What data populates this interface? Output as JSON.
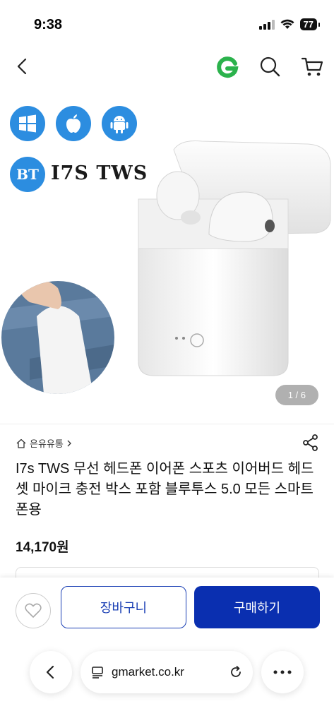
{
  "status": {
    "time": "9:38",
    "battery": "77"
  },
  "hero": {
    "brand_badge": "BT",
    "model_text": "I7S TWS",
    "page_indicator": "1 / 6"
  },
  "product": {
    "seller": "은유유통",
    "title": "I7s TWS 무선 헤드폰 이어폰 스포츠 이어버드 헤드셋 마이크 충전 박스 포함 블루투스 5.0 모든 스마트폰용",
    "price": "14,170",
    "price_unit": "원"
  },
  "actions": {
    "cart_label": "장바구니",
    "buy_label": "구매하기"
  },
  "browser": {
    "url": "gmarket.co.kr"
  },
  "colors": {
    "brand_green": "#2bb24c",
    "primary_blue": "#0a2fb0",
    "badge_blue": "#2c8de0"
  }
}
